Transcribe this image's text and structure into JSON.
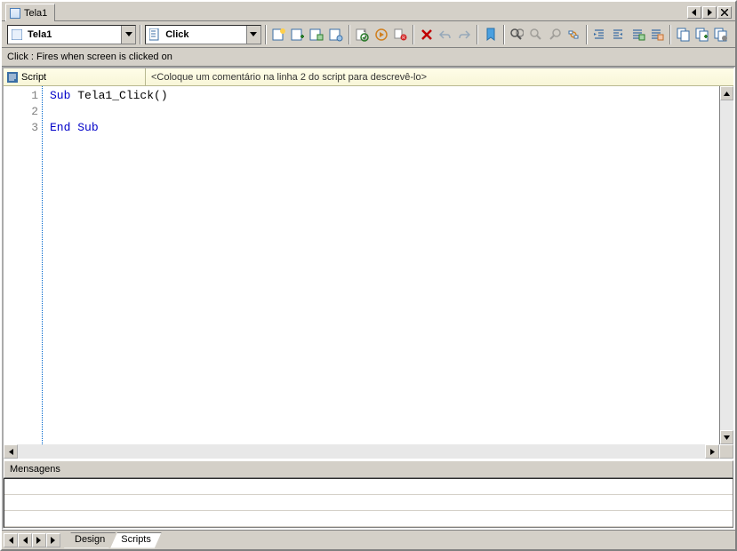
{
  "topTab": {
    "label": "Tela1"
  },
  "toolbar": {
    "objectCombo": {
      "value": "Tela1"
    },
    "eventCombo": {
      "value": "Click"
    }
  },
  "hint": "Click : Fires when screen is clicked on",
  "scriptHeader": {
    "label": "Script",
    "comment": "<Coloque um comentário na linha 2 do script para descrevê-lo>"
  },
  "code": {
    "lines": [
      {
        "n": "1",
        "tokens": [
          {
            "t": "Sub",
            "k": true
          },
          {
            "t": " Tela1_Click()",
            "k": false
          }
        ]
      },
      {
        "n": "2",
        "tokens": []
      },
      {
        "n": "3",
        "tokens": [
          {
            "t": "End",
            "k": true
          },
          {
            "t": " ",
            "k": false
          },
          {
            "t": "Sub",
            "k": true
          }
        ]
      }
    ]
  },
  "messages": {
    "title": "Mensagens"
  },
  "bottomTabs": {
    "design": "Design",
    "scripts": "Scripts"
  }
}
